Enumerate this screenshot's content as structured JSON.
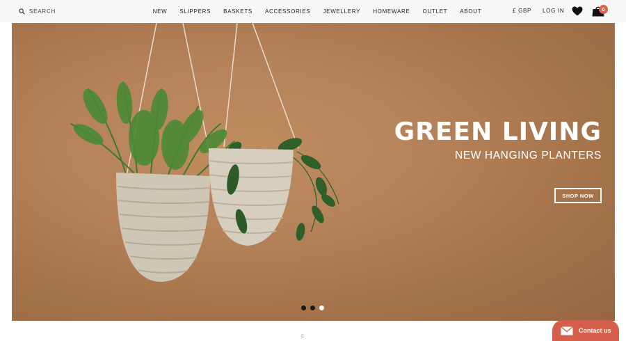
{
  "header": {
    "search": {
      "placeholder": "SEARCH",
      "icon": "search-icon"
    },
    "nav": [
      "NEW",
      "SLIPPERS",
      "BASKETS",
      "ACCESSORIES",
      "JEWELLERY",
      "HOMEWARE",
      "OUTLET",
      "ABOUT"
    ],
    "currency": "£ GBP",
    "login": "LOG IN",
    "wishlist_icon": "heart-icon",
    "cart_icon": "shopping-bag-icon",
    "cart_count": "0"
  },
  "hero": {
    "title": "GREEN LIVING",
    "subtitle": "NEW HANGING PLANTERS",
    "cta": "SHOP NOW",
    "slides": 3,
    "active_slide": 3,
    "colors": {
      "background": "#b5825a",
      "text": "#ffffff"
    }
  },
  "contact": {
    "label": "Contact us",
    "icon": "envelope-icon",
    "color": "#d4604c"
  },
  "below": {
    "glyph": "c"
  }
}
